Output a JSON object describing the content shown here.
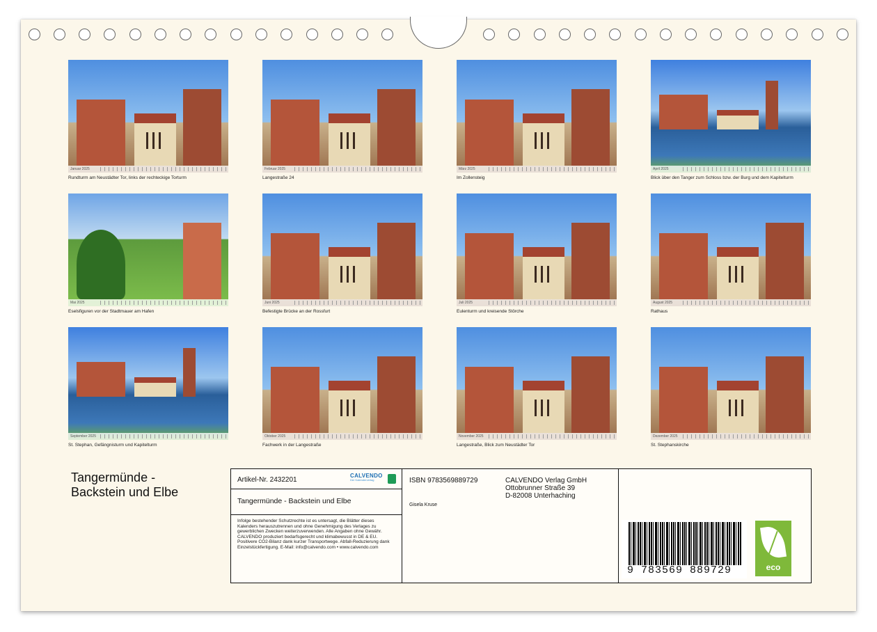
{
  "tiles": [
    {
      "month": "Januar 2025",
      "caption": "Rundturm am Neustädter Tor, links der rechteckige Torturm"
    },
    {
      "month": "Februar 2025",
      "caption": "Langestraße 24"
    },
    {
      "month": "März 2025",
      "caption": "Im Zollensteig"
    },
    {
      "month": "April 2025",
      "caption": "Blick über den Tanger zum Schloss bzw. der Burg und dem Kapitelturm"
    },
    {
      "month": "Mai 2025",
      "caption": "Eselsfiguren vor der Stadtmauer am Hafen"
    },
    {
      "month": "Juni 2025",
      "caption": "Befestigte Brücke an der Rossfurt"
    },
    {
      "month": "Juli 2025",
      "caption": "Eulenturm und kreisende Störche"
    },
    {
      "month": "August 2025",
      "caption": "Rathaus"
    },
    {
      "month": "September 2025",
      "caption": "St. Stephan, Gefängnisturm und Kapitelturm"
    },
    {
      "month": "Oktober 2025",
      "caption": "Fachwerk in der Langestraße"
    },
    {
      "month": "November 2025",
      "caption": "Langestraße, Blick zum Neustädter Tor"
    },
    {
      "month": "Dezember 2025",
      "caption": "St. Stephanskirche"
    }
  ],
  "cover_title_line1": "Tangermünde -",
  "cover_title_line2": "Backstein und Elbe",
  "info": {
    "article": "Artikel-Nr. 2432201",
    "logo_name": "CALVENDO",
    "logo_tag": "Der Kalenderverlag",
    "title": "Tangermünde - Backstein und Elbe",
    "legal": "Infolge bestehender Schutzrechte ist es untersagt, die Blätter dieses Kalenders herauszutrennen und ohne Genehmigung des Verlages zu gewerblichen Zwecken weiterzuverwenden. Alle Angaben ohne Gewähr. CALVENDO produziert bedarfsgerecht und klimabewusst in DE & EU. Positivere CO2-Bilanz dank kurzer Transportwege. Abfall-Reduzierung dank Einzelstückfertigung. E-Mail: info@calvendo.com • www.calvendo.com",
    "isbn": "ISBN 9783569889729",
    "publisher_name": "CALVENDO Verlag GmbH",
    "publisher_street": "Ottobrunner Straße 39",
    "publisher_city": "D-82008 Unterhaching",
    "author": "Gisela Kruse",
    "barcode_digits": "9 783569 889729",
    "eco_label": "eco"
  }
}
